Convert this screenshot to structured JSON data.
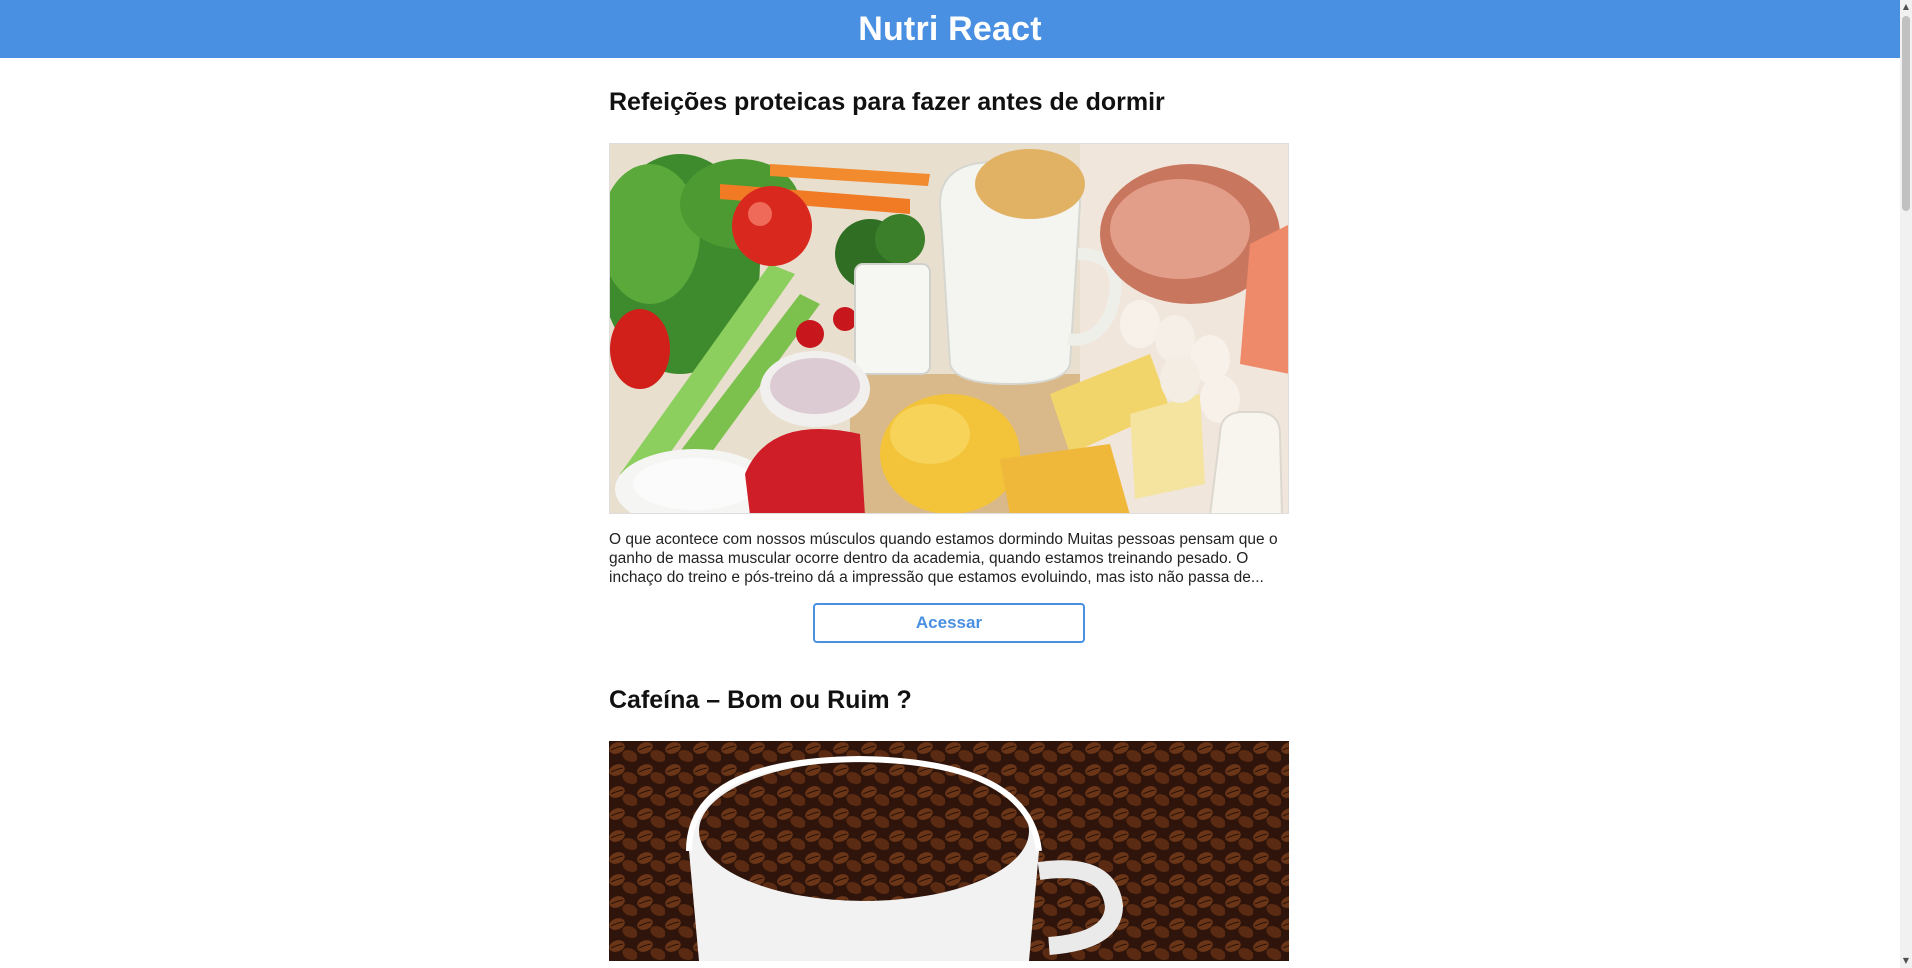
{
  "header": {
    "brand": "Nutri React"
  },
  "posts": [
    {
      "title": "Refeições proteicas para fazer antes de dormir",
      "image": "protein-foods-image",
      "excerpt": "O que acontece com nossos músculos quando estamos dormindo Muitas pessoas pensam que o ganho de massa muscular ocorre dentro da academia, quando estamos treinando pesado. O inchaço do treino e pós-treino dá a impressão que estamos evoluindo, mas isto não passa de...",
      "button": "Acessar"
    },
    {
      "title": "Cafeína – Bom ou Ruim ?",
      "image": "coffee-beans-image"
    }
  ],
  "colors": {
    "accent": "#4a90e2",
    "background": "#ffffff",
    "text": "#111111"
  }
}
